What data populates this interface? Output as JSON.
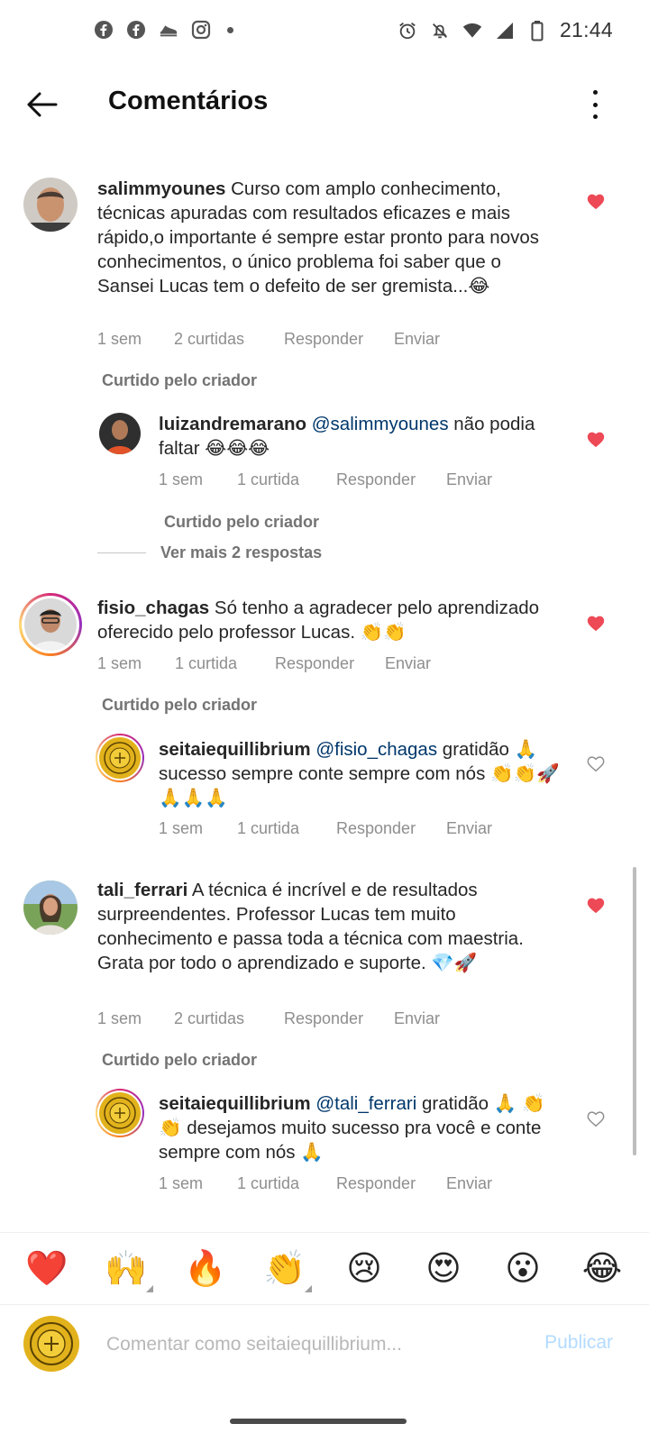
{
  "status_bar": {
    "time": "21:44",
    "left_icons": [
      "facebook-icon",
      "facebook-icon",
      "shoe-icon",
      "instagram-icon"
    ],
    "right_icons": [
      "alarm-icon",
      "mute-icon",
      "wifi-icon",
      "signal-icon",
      "battery-icon"
    ]
  },
  "header": {
    "title": "Comentários"
  },
  "liked_by_creator": "Curtido pelo criador",
  "comments": [
    {
      "username": "salimmyounes",
      "text": "Curso com amplo conhecimento, técnicas apuradas com resultados eficazes e mais rápido,o importante é sempre estar pronto para novos conhecimentos, o único problema foi saber que o Sansei Lucas tem o defeito de ser gremista...😂",
      "time": "1 sem",
      "likes": "2 curtidas",
      "reply": "Responder",
      "send": "Enviar",
      "liked": true,
      "liked_by_creator": true
    },
    {
      "username": "luizandremarano",
      "mention": "@salimmyounes",
      "text": "não podia faltar 😂😂😂",
      "time": "1 sem",
      "likes": "1 curtida",
      "reply": "Responder",
      "send": "Enviar",
      "liked": true,
      "liked_by_creator": true
    },
    {
      "username": "fisio_chagas",
      "text": "Só tenho a agradecer pelo aprendizado oferecido pelo professor Lucas. 👏👏",
      "time": "1 sem",
      "likes": "1 curtida",
      "reply": "Responder",
      "send": "Enviar",
      "liked": true,
      "liked_by_creator": true
    },
    {
      "username": "seitaiequillibrium",
      "mention": "@fisio_chagas",
      "text": "gratidão 🙏 sucesso sempre conte sempre com nós 👏👏🚀🙏🙏🙏",
      "time": "1 sem",
      "likes": "1 curtida",
      "reply": "Responder",
      "send": "Enviar",
      "liked": false
    },
    {
      "username": "tali_ferrari",
      "text": "A técnica é incrível e de resultados surpreendentes. Professor Lucas tem muito conhecimento e passa toda a técnica com maestria. Grata por todo o aprendizado e suporte. 💎🚀",
      "time": "1 sem",
      "likes": "2 curtidas",
      "reply": "Responder",
      "send": "Enviar",
      "liked": true,
      "liked_by_creator": true
    },
    {
      "username": "seitaiequillibrium",
      "mention": "@tali_ferrari",
      "text": "gratidão 🙏 👏👏 desejamos muito sucesso pra você e conte sempre com nós 🙏",
      "time": "1 sem",
      "likes": "1 curtida",
      "reply": "Responder",
      "send": "Enviar",
      "liked": false
    }
  ],
  "view_more_replies": "Ver mais 2 respostas",
  "emoji_bar": [
    "❤️",
    "🙌",
    "🔥",
    "👏",
    "😢",
    "😍",
    "😮",
    "😂"
  ],
  "input": {
    "placeholder": "Comentar como seitaiequillibrium...",
    "publish_label": "Publicar"
  },
  "colors": {
    "heart_red": "#ed4956",
    "mention_blue": "#00376b",
    "publish_disabled": "#b3dbff",
    "story_ring": [
      "#feda75",
      "#fa7e1e",
      "#d62976",
      "#962fbf"
    ]
  }
}
